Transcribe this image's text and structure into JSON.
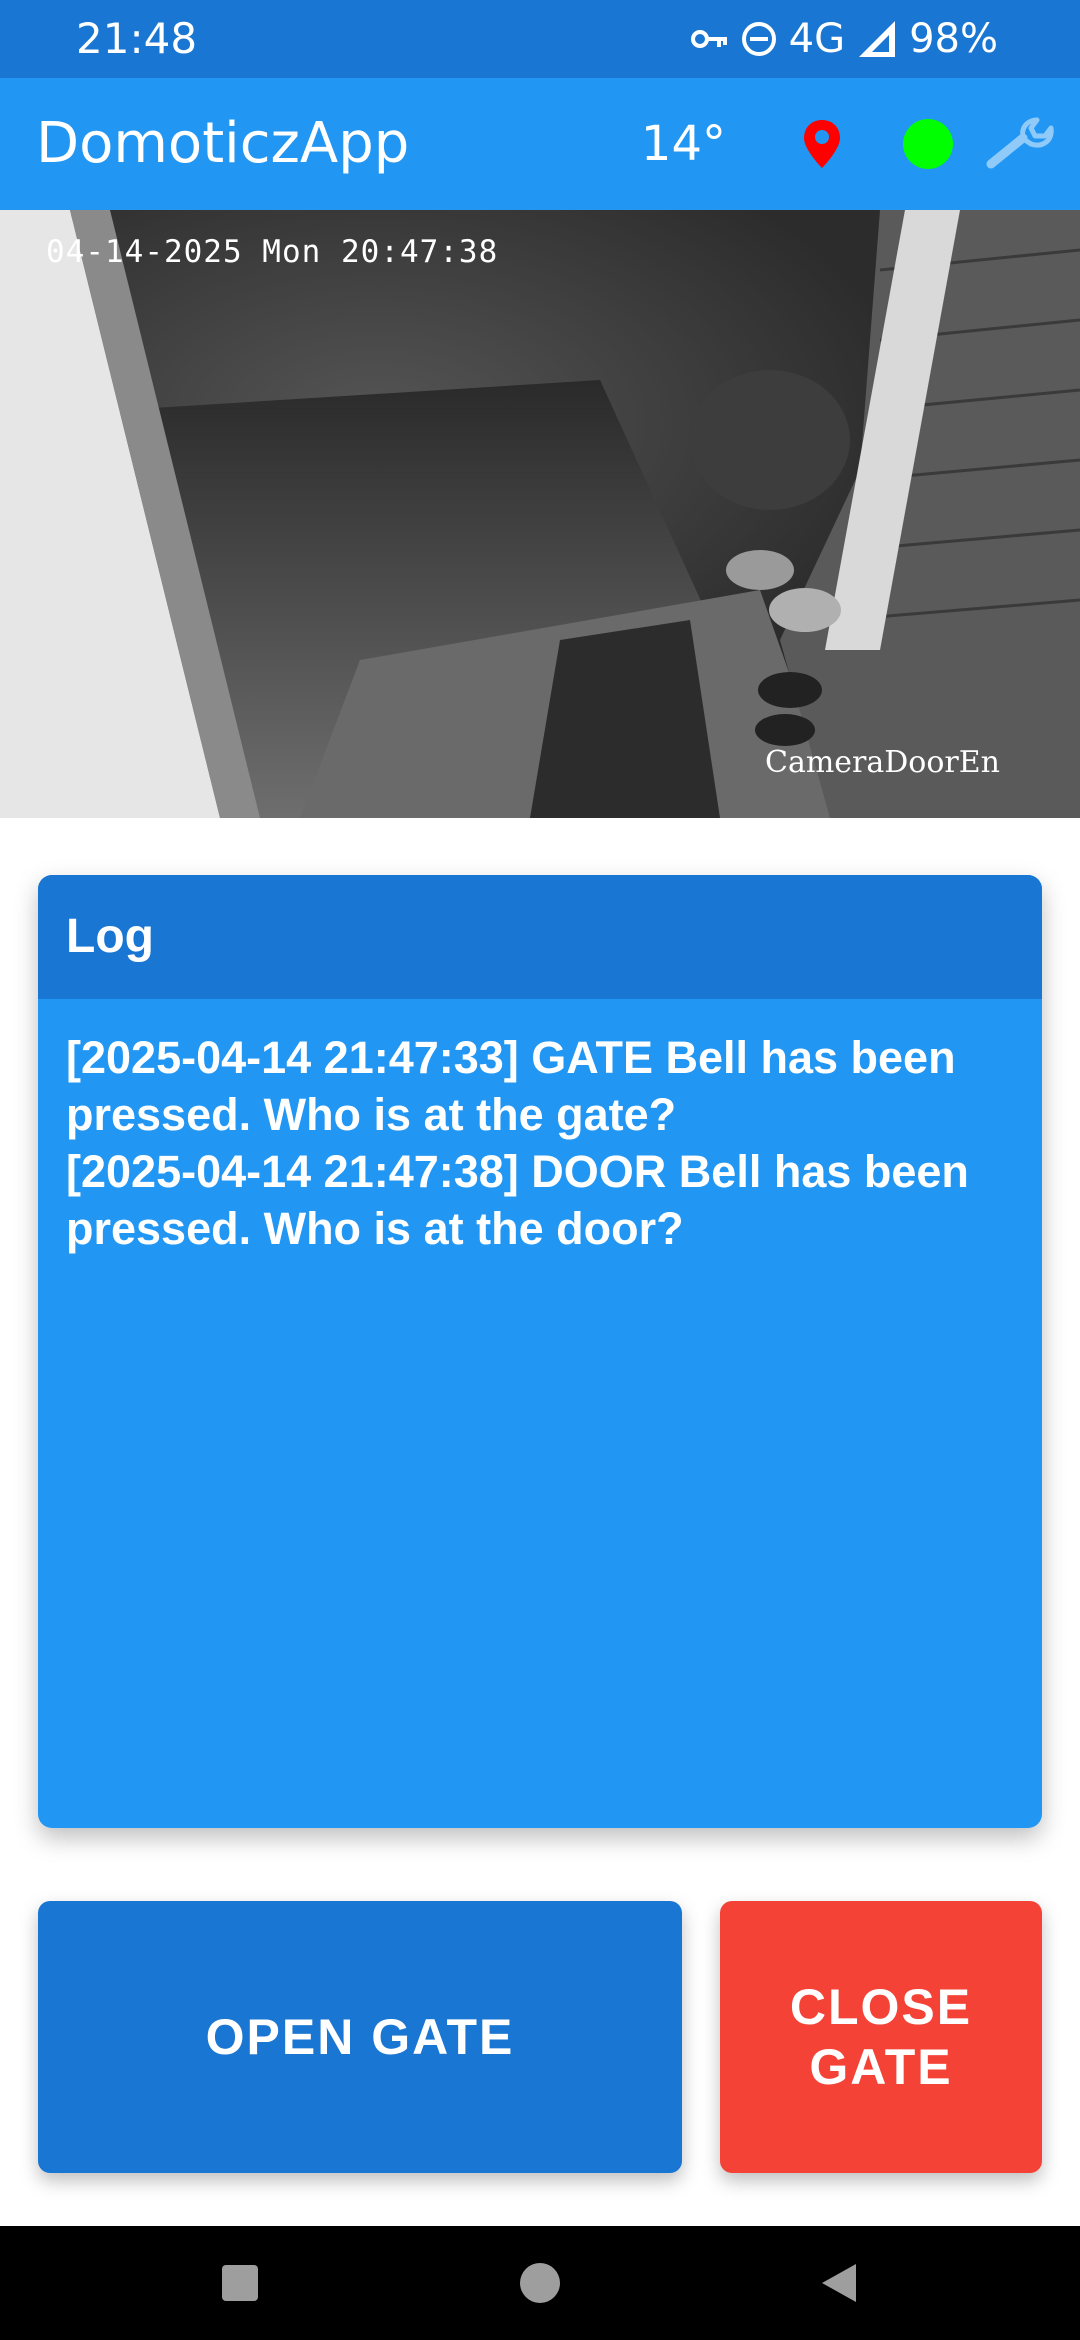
{
  "status_bar": {
    "time": "21:48",
    "network": "4G",
    "battery": "98%",
    "icons": [
      "vpn-key-icon",
      "do-not-disturb-icon",
      "signal-icon"
    ]
  },
  "app_bar": {
    "title": "DomoticzApp",
    "temperature": "14°",
    "icons": [
      "location-pin-icon",
      "status-dot-icon",
      "wrench-icon"
    ],
    "colors": {
      "background": "#2196f3",
      "pin": "#ff0000",
      "status_dot": "#00ff00",
      "wrench": "#90caf9"
    }
  },
  "camera": {
    "timestamp": "04-14-2025 Mon 20:47:38",
    "name": "CameraDoorEn"
  },
  "log": {
    "title": "Log",
    "entries": [
      "[2025-04-14 21:47:33] GATE Bell has been pressed. Who is at the gate?",
      "[2025-04-14 21:47:38] DOOR Bell has been pressed. Who is at the door?"
    ],
    "colors": {
      "header": "#1976d2",
      "body": "#2196f3"
    }
  },
  "buttons": {
    "open_gate": "OPEN GATE",
    "close_gate": "CLOSE GATE",
    "colors": {
      "open_gate": "#1976d2",
      "close_gate": "#f44336"
    }
  },
  "nav_bar": {
    "icons": [
      "recents-square-icon",
      "home-circle-icon",
      "back-triangle-icon"
    ]
  }
}
